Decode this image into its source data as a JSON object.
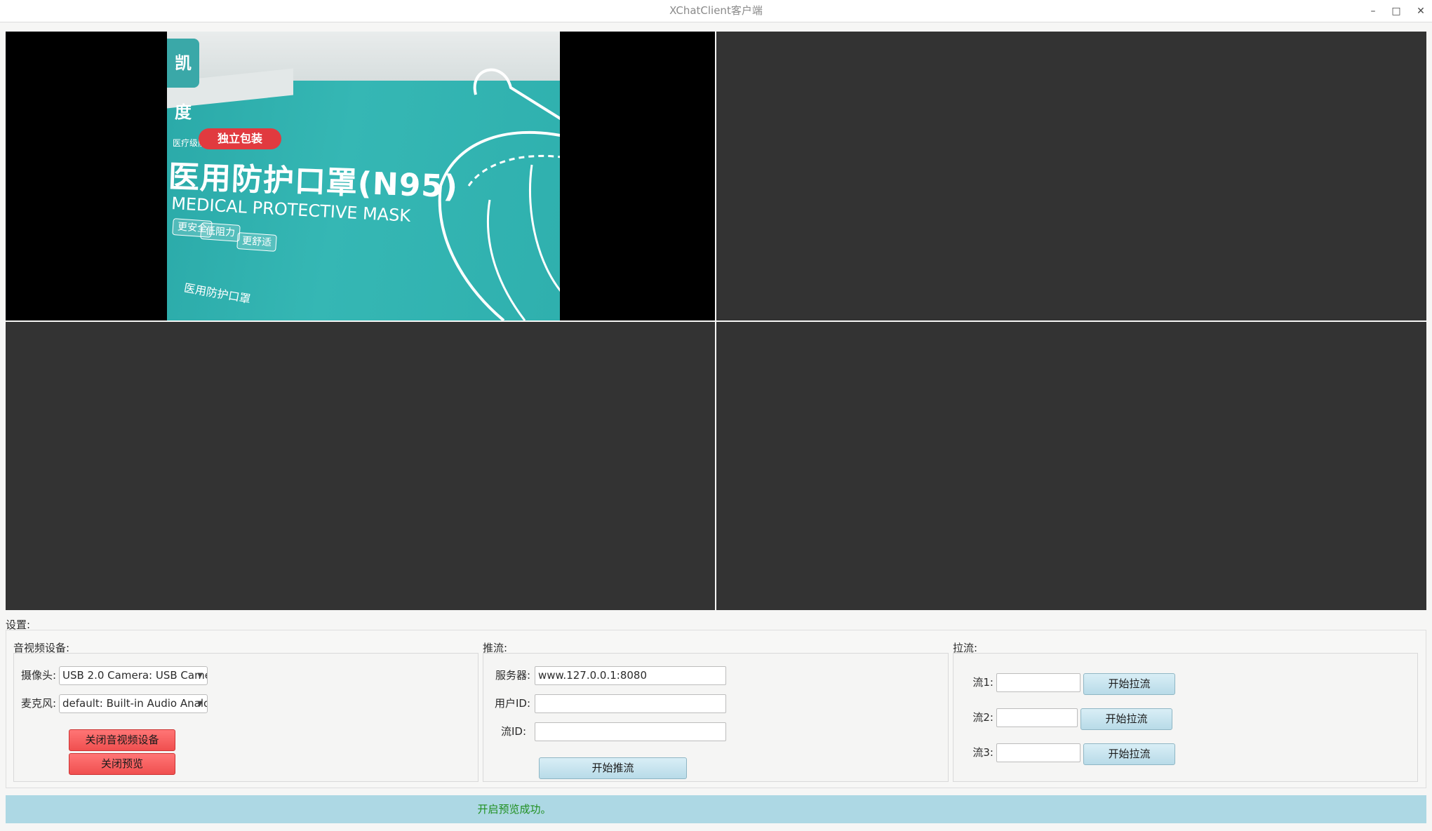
{
  "window": {
    "title": "XChatClient客户端",
    "controls": {
      "minimize": "–",
      "maximize": "□",
      "close": "✕"
    }
  },
  "video": {
    "camera_frame": {
      "badge": "凯度",
      "small_print": "医疗级防护",
      "tag": "独立包装",
      "product_title": "医用防护口罩(N95)",
      "product_subtitle": "MEDICAL PROTECTIVE MASK",
      "pills": [
        "更安全",
        "低阻力",
        "更舒适"
      ],
      "bottom_logo": "医用防护口罩"
    }
  },
  "settings": {
    "label": "设置:",
    "av": {
      "label": "音视频设备:",
      "camera_label": "摄像头:",
      "camera_value": "USB 2.0 Camera: USB Came",
      "mic_label": "麦克风:",
      "mic_value": "default: Built-in Audio Analog",
      "close_device_button": "关闭音视频设备",
      "close_preview_button": "关闭预览"
    },
    "push": {
      "label": "推流:",
      "server_label": "服务器:",
      "server_value": "www.127.0.0.1:8080",
      "user_label": "用户ID:",
      "user_value": "",
      "stream_label": "流ID:",
      "stream_value": "",
      "start_button": "开始推流"
    },
    "pull": {
      "label": "拉流:",
      "streams": [
        {
          "label": "流1:",
          "value": "",
          "button": "开始拉流"
        },
        {
          "label": "流2:",
          "value": "",
          "button": "开始拉流"
        },
        {
          "label": "流3:",
          "value": "",
          "button": "开始拉流"
        }
      ]
    }
  },
  "status": {
    "text": "开启预览成功。",
    "text_color": "#1f8f1f",
    "background": "#add8e4"
  },
  "colors": {
    "video_empty": "#333333",
    "danger_button": "#f04f4f",
    "primary_button": "#b8dbe8"
  }
}
